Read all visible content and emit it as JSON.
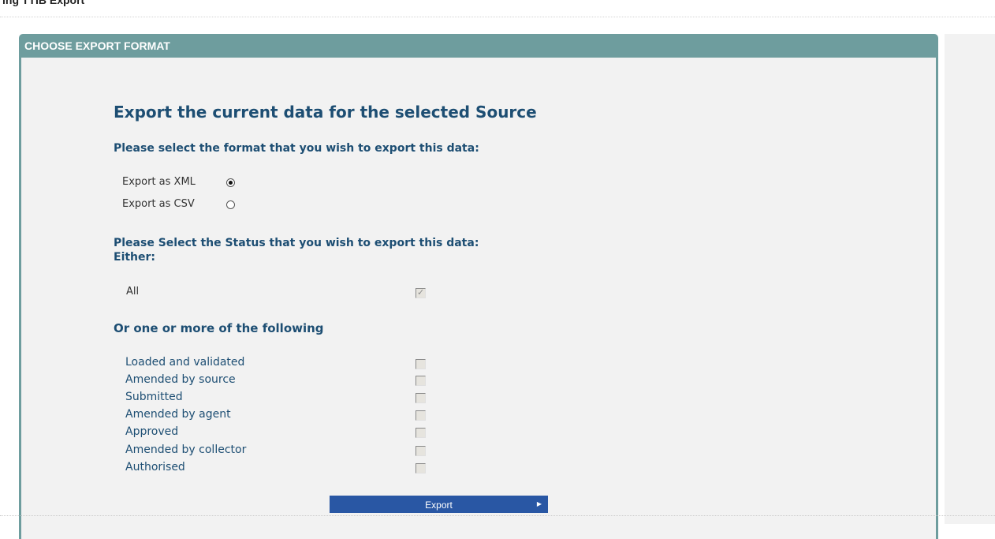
{
  "page": {
    "title": "ing TTIB Export"
  },
  "panel": {
    "header": "CHOOSE EXPORT FORMAT",
    "heading": "Export the current data for the selected Source",
    "format_prompt": "Please select the format that you wish to export this data:",
    "formats": [
      {
        "label": "Export as XML",
        "selected": true
      },
      {
        "label": "Export as CSV",
        "selected": false
      }
    ],
    "status_prompt": "Please Select the Status that you wish to export this data:",
    "status_either": "Either:",
    "all": {
      "label": "All",
      "checked": true
    },
    "or_prompt": "Or one or more of the following",
    "statuses": [
      {
        "label": "Loaded and validated",
        "checked": false
      },
      {
        "label": "Amended by source",
        "checked": false
      },
      {
        "label": "Submitted",
        "checked": false
      },
      {
        "label": "Amended by agent",
        "checked": false
      },
      {
        "label": "Approved",
        "checked": false
      },
      {
        "label": "Amended by collector",
        "checked": false
      },
      {
        "label": "Authorised",
        "checked": false
      }
    ],
    "export_button": "Export"
  },
  "colors": {
    "panel_frame": "#6e9d9e",
    "panel_body": "#f2f2f2",
    "heading_text": "#1d4e73",
    "button": "#2957a4"
  }
}
